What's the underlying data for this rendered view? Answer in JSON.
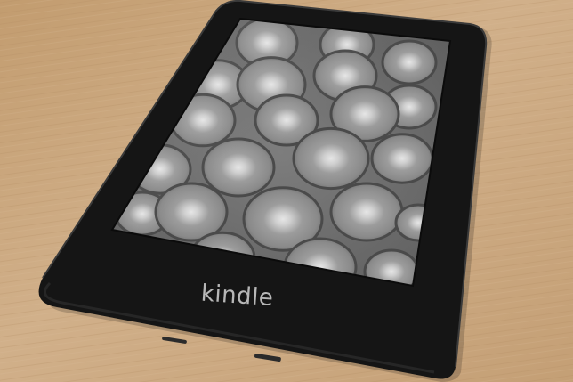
{
  "device": {
    "brand_text": "kindle"
  },
  "screen": {
    "content": "log-ends-wallpaper"
  },
  "colors": {
    "table": "#c9a77f",
    "bezel": "#151515",
    "screen_base": "#8a8a8a",
    "brand_text": "#b7b7b7"
  }
}
